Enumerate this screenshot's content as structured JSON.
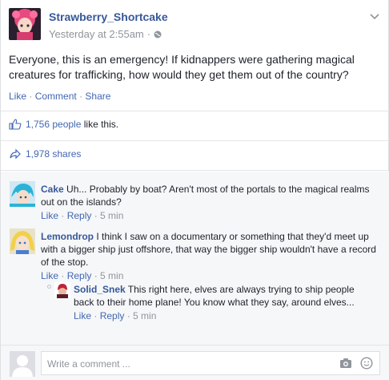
{
  "post": {
    "author": "Strawberry_Shortcake",
    "time": "Yesterday at 2:55am",
    "separator": "·",
    "text": "Everyone, this is an emergency! If kidnappers were gathering magical creatures for trafficking, how would they get them out of the country?",
    "actions": {
      "like": "Like",
      "comment": "Comment",
      "share": "Share"
    },
    "likes_link": "1,756 people",
    "likes_suffix": " like this.",
    "shares": "1,978 shares"
  },
  "comments": [
    {
      "name": "Cake",
      "text": " Uh... Probably by boat? Aren't most of the portals to the magical realms out on the islands?",
      "like": "Like",
      "reply": "Reply",
      "time": "5 min"
    },
    {
      "name": "Lemondrop",
      "text": " I think I saw on a documentary or something that they'd meet up with a bigger ship just offshore, that way the bigger ship wouldn't have a record of the stop.",
      "like": "Like",
      "reply": "Reply",
      "time": "5 min"
    },
    {
      "name": "Solid_Snek",
      "text": " This right here, elves are always trying to ship people back to their home plane! You know what they say, around elves...",
      "like": "Like",
      "reply": "Reply",
      "time": "5 min"
    }
  ],
  "composer": {
    "placeholder": "Write a comment ..."
  },
  "colors": {
    "link": "#4267b2",
    "name": "#365899",
    "muted": "#90949c"
  }
}
